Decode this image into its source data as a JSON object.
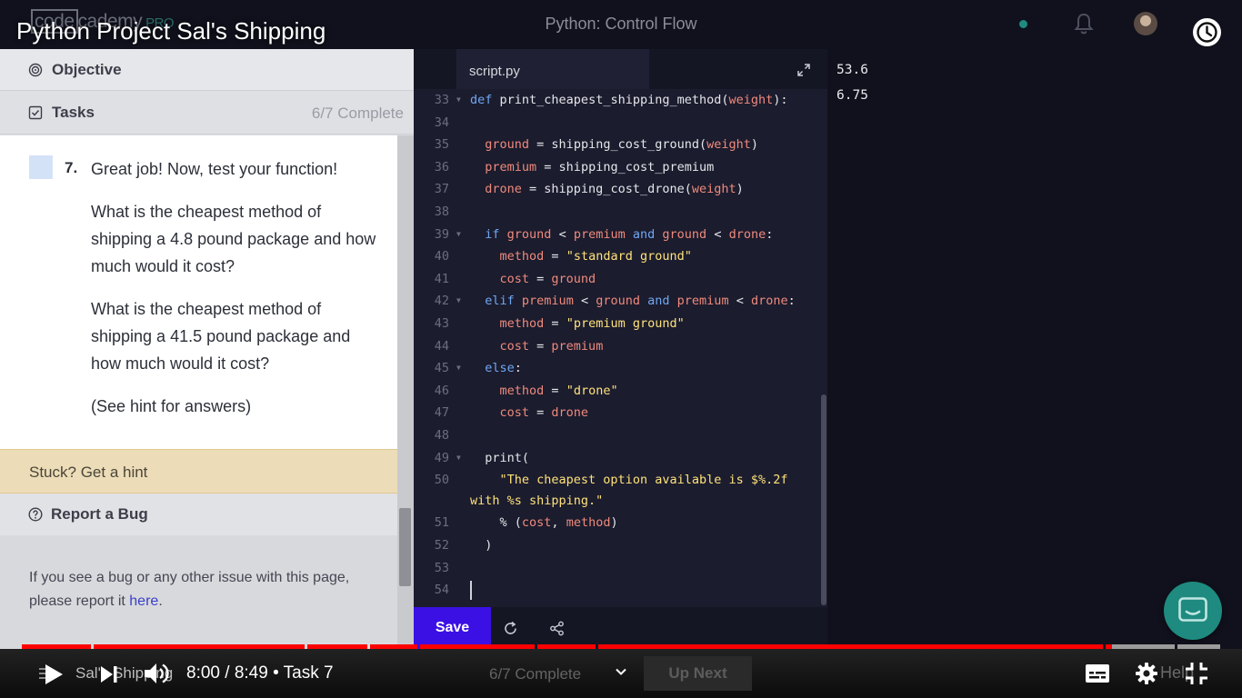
{
  "video": {
    "title": "Python Project Sal's Shipping",
    "time": "8:00 / 8:49 • Task 7",
    "playlist_title": "Sal's Shipping",
    "chapter_progress": "6/7 Complete",
    "up_next_label": "Up Next",
    "help_label": "Help",
    "played_fraction": 0.91
  },
  "app": {
    "logo_code": "code",
    "logo_cademy": "cademy",
    "logo_pro": "PRO",
    "course_title": "Python: Control Flow",
    "status_color": "#1f8a80"
  },
  "left_panel": {
    "objective_label": "Objective",
    "tasks_label": "Tasks",
    "tasks_progress": "6/7 Complete",
    "task": {
      "number": "7.",
      "line1": "Great job! Now, test your function!",
      "q1": "What is the cheapest method of shipping a 4.8 pound package and how much would it cost?",
      "q2": "What is the cheapest method of shipping a 41.5 pound package and how much would it cost?",
      "hint_note": "(See hint for answers)"
    },
    "hint_label": "Stuck? Get a hint",
    "report_bug_label": "Report a Bug",
    "bug_text": "If you see a bug or any other issue with this page, please report it ",
    "bug_link": "here",
    "bug_text_end": "."
  },
  "editor": {
    "file_name": "script.py",
    "save_label": "Save",
    "accent": "#3a10e5",
    "cursor_line": "54",
    "lines": [
      {
        "n": "33",
        "fold": true,
        "html": "<span class=\"kw\">def</span> <span class=\"fn\">print_cheapest_shipping_method</span>(<span class=\"var\">weight</span>):"
      },
      {
        "n": "34",
        "fold": false,
        "html": ""
      },
      {
        "n": "35",
        "fold": false,
        "html": "  <span class=\"var\">ground</span> = shipping_cost_ground(<span class=\"var\">weight</span>)"
      },
      {
        "n": "36",
        "fold": false,
        "html": "  <span class=\"var\">premium</span> = shipping_cost_premium"
      },
      {
        "n": "37",
        "fold": false,
        "html": "  <span class=\"var\">drone</span> = shipping_cost_drone(<span class=\"var\">weight</span>)"
      },
      {
        "n": "38",
        "fold": false,
        "html": ""
      },
      {
        "n": "39",
        "fold": true,
        "html": "  <span class=\"kw\">if</span> <span class=\"var\">ground</span> &lt; <span class=\"var\">premium</span> <span class=\"kw\">and</span> <span class=\"var\">ground</span> &lt; <span class=\"var\">drone</span>:"
      },
      {
        "n": "40",
        "fold": false,
        "html": "    <span class=\"var\">method</span> = <span class=\"str\">\"standard ground\"</span>"
      },
      {
        "n": "41",
        "fold": false,
        "html": "    <span class=\"var\">cost</span> = <span class=\"var\">ground</span>"
      },
      {
        "n": "42",
        "fold": true,
        "html": "  <span class=\"kw\">elif</span> <span class=\"var\">premium</span> &lt; <span class=\"var\">ground</span> <span class=\"kw\">and</span> <span class=\"var\">premium</span> &lt; <span class=\"var\">drone</span>:"
      },
      {
        "n": "43",
        "fold": false,
        "html": "    <span class=\"var\">method</span> = <span class=\"str\">\"premium ground\"</span>"
      },
      {
        "n": "44",
        "fold": false,
        "html": "    <span class=\"var\">cost</span> = <span class=\"var\">premium</span>"
      },
      {
        "n": "45",
        "fold": true,
        "html": "  <span class=\"kw\">else</span>:"
      },
      {
        "n": "46",
        "fold": false,
        "html": "    <span class=\"var\">method</span> = <span class=\"str\">\"drone\"</span>"
      },
      {
        "n": "47",
        "fold": false,
        "html": "    <span class=\"var\">cost</span> = <span class=\"var\">drone</span>"
      },
      {
        "n": "48",
        "fold": false,
        "html": ""
      },
      {
        "n": "49",
        "fold": true,
        "html": "  print("
      },
      {
        "n": "50",
        "fold": false,
        "html": "    <span class=\"str\">\"The cheapest option available is $%.2f</span>",
        "cont": "<span class=\"str\">with %s shipping.\"</span>"
      },
      {
        "n": "51",
        "fold": false,
        "html": "    % (<span class=\"var\">cost</span>, <span class=\"var\">method</span>)"
      },
      {
        "n": "52",
        "fold": false,
        "html": "  )"
      },
      {
        "n": "53",
        "fold": false,
        "html": ""
      },
      {
        "n": "54",
        "fold": false,
        "html": ""
      }
    ]
  },
  "output": {
    "lines": [
      "53.6",
      "6.75"
    ]
  }
}
